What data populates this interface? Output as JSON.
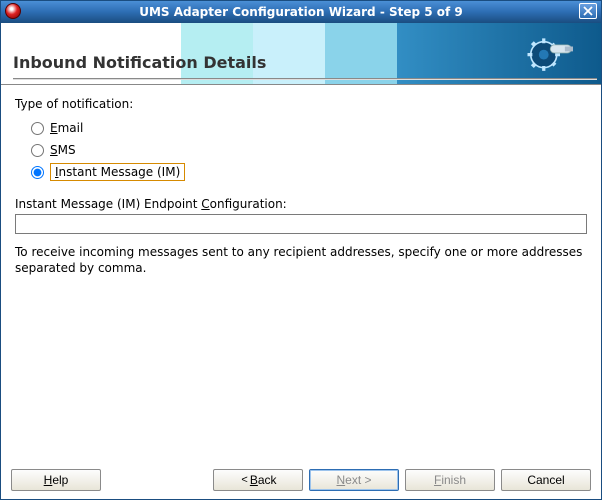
{
  "window": {
    "title": "UMS Adapter Configuration Wizard - Step 5 of 9"
  },
  "banner": {
    "heading": "Inbound Notification Details"
  },
  "form": {
    "type_label": "Type of notification:",
    "options": {
      "email": "Email",
      "sms": "SMS",
      "im": "Instant Message (IM)"
    },
    "selected": "im",
    "endpoint_label_pre": "Instant Message (IM) Endpoint ",
    "endpoint_label_u": "C",
    "endpoint_label_post": "onfiguration:",
    "endpoint_value": "",
    "hint": "To receive incoming messages sent to any recipient addresses, specify one or more addresses separated by comma."
  },
  "buttons": {
    "help_u": "H",
    "help_post": "elp",
    "back_pre": "< ",
    "back_u": "B",
    "back_post": "ack",
    "next_u": "N",
    "next_post": "ext >",
    "finish_u": "F",
    "finish_post": "inish",
    "cancel": "Cancel"
  }
}
